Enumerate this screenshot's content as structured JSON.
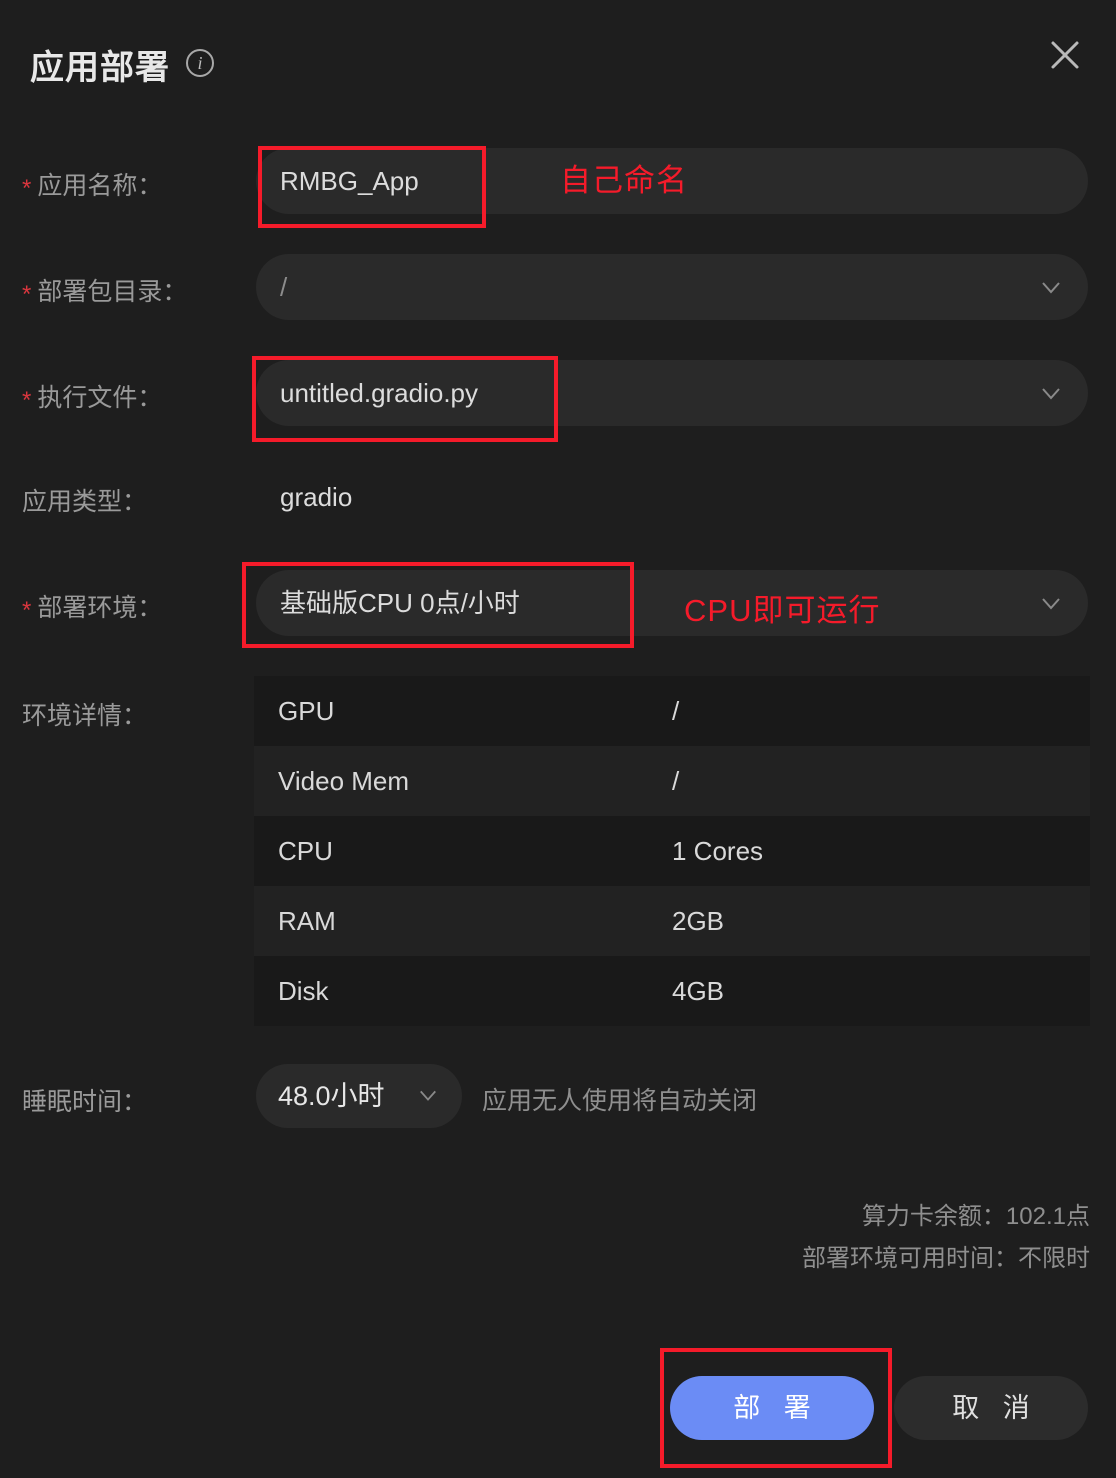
{
  "dialog": {
    "title": "应用部署",
    "info_icon": "info-icon",
    "close_icon": "close-icon"
  },
  "form": {
    "rows": [
      {
        "label": "应用名称：",
        "required": true,
        "value": "RMBG_App",
        "kind": "input",
        "highlighted": true
      },
      {
        "label": "部署包目录：",
        "required": true,
        "value": "/",
        "kind": "select",
        "placeholder": true,
        "highlighted": false
      },
      {
        "label": "执行文件：",
        "required": true,
        "value": "untitled.gradio.py",
        "kind": "select",
        "highlighted": true
      },
      {
        "label": "应用类型：",
        "required": false,
        "value": "gradio",
        "kind": "text",
        "highlighted": false
      },
      {
        "label": "部署环境：",
        "required": true,
        "value": "基础版CPU 0点/小时",
        "kind": "select",
        "highlighted": true
      }
    ]
  },
  "annotations": [
    {
      "text": "自己命名",
      "color": "#f51b2a"
    },
    {
      "text": "CPU即可运行",
      "color": "#f51b2a"
    }
  ],
  "env_details": {
    "label": "环境详情：",
    "rows": [
      {
        "key": "GPU",
        "value": "/"
      },
      {
        "key": "Video Mem",
        "value": "/"
      },
      {
        "key": "CPU",
        "value": "1 Cores"
      },
      {
        "key": "RAM",
        "value": "2GB"
      },
      {
        "key": "Disk",
        "value": "4GB"
      }
    ]
  },
  "sleep": {
    "label": "睡眠时间：",
    "value": "48.0小时",
    "hint": "应用无人使用将自动关闭"
  },
  "balance": {
    "line1": "算力卡余额：102.1点",
    "line2": "部署环境可用时间：不限时"
  },
  "footer": {
    "deploy_label": "部 署",
    "cancel_label": "取 消",
    "deploy_color": "#6b8cf5"
  }
}
